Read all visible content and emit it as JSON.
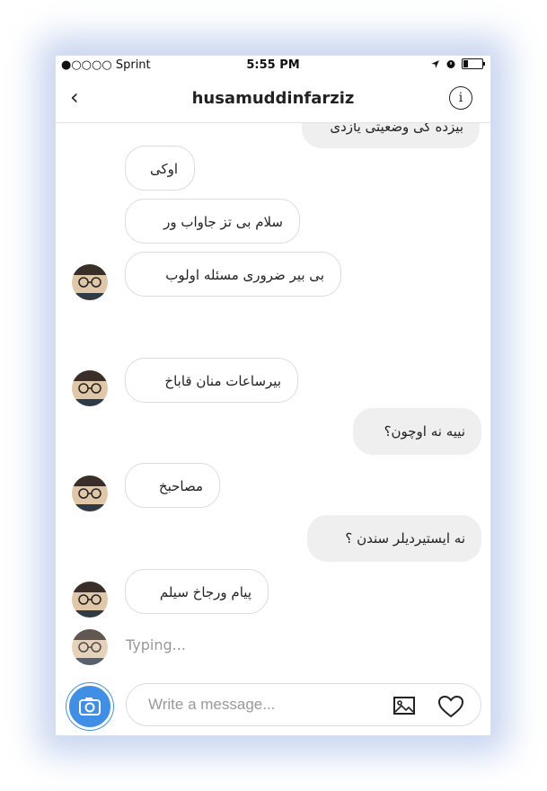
{
  "status_bar": {
    "carrier": "●○○○○ Sprint",
    "time": "5:55 PM"
  },
  "header": {
    "title": "husamuddinfarziz",
    "back_glyph": "‹",
    "info_glyph": "i"
  },
  "messages": [
    {
      "dir": "out",
      "text": "بیزده کی وضعیتی یازدی",
      "partial": true
    },
    {
      "dir": "in",
      "text": "اوکی"
    },
    {
      "dir": "in",
      "text": "سلام بی تز جاواب ور"
    },
    {
      "dir": "in",
      "text": "بی بیر ضروری مسئله اولوب"
    },
    {
      "dir": "in",
      "text": "بیرساعات منان قاباخ"
    },
    {
      "dir": "out",
      "text": "نییه نه اوچون؟"
    },
    {
      "dir": "in",
      "text": "مصاحبخ"
    },
    {
      "dir": "out",
      "text": "نه ایستیردیلر سندن ؟"
    },
    {
      "dir": "in",
      "text": "پیام ورجاخ سیلم"
    }
  ],
  "typing_indicator": "Typing...",
  "composer": {
    "placeholder": "Write a message..."
  },
  "icons": [
    "back-chevron",
    "info-icon",
    "camera-icon",
    "image-icon",
    "heart-icon",
    "wifi-icon",
    "location-icon",
    "alarm-icon",
    "battery-icon"
  ],
  "colors": {
    "accent": "#3f8fe6",
    "outgoing_bubble": "#efefef",
    "incoming_border": "#dcdcdc"
  }
}
